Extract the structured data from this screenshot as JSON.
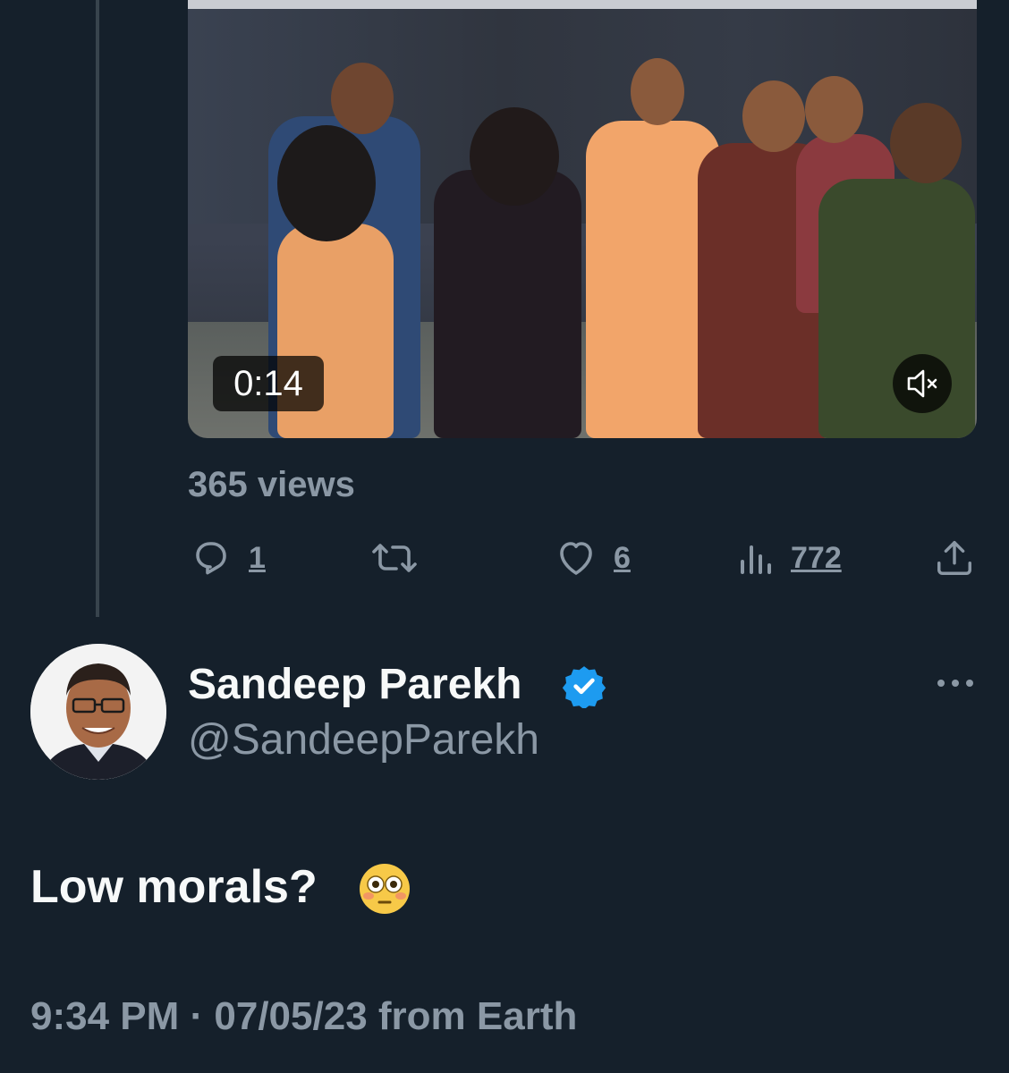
{
  "video": {
    "duration": "0:14",
    "mute_icon": "muted-speaker-icon",
    "views": "365 views"
  },
  "actions": [
    {
      "icon": "reply-icon",
      "count": "1"
    },
    {
      "icon": "retweet-icon",
      "count": ""
    },
    {
      "icon": "like-icon",
      "count": "6"
    },
    {
      "icon": "analytics-icon",
      "count": "772"
    },
    {
      "icon": "share-icon",
      "count": ""
    }
  ],
  "reply": {
    "name": "Sandeep Parekh",
    "verified_icon": "verified-badge-icon",
    "verified_color": "#1d9bf0",
    "handle": "@SandeepParekh",
    "text": "Low morals?",
    "emoji": "flushed-face-emoji",
    "timestamp": "9:34 PM · 07/05/23 from Earth"
  },
  "colors": {
    "background": "#15202b",
    "primary_text": "#f7f9f9",
    "secondary_text": "#8b98a5",
    "thread_line": "#38444d"
  }
}
